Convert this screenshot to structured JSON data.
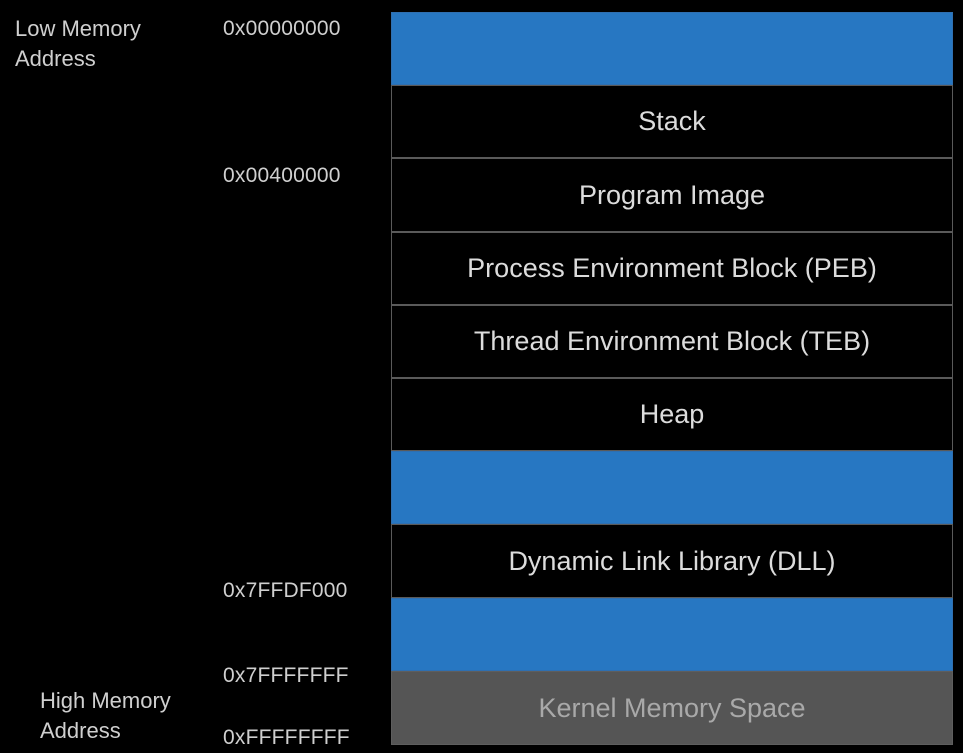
{
  "labels": {
    "low": "Low Memory\nAddress",
    "high": "High Memory\nAddress"
  },
  "addresses": [
    "0x00000000",
    "0x00400000",
    "0x7FFDF000",
    "0x7FFFFFFF",
    "0xFFFFFFFF"
  ],
  "segments": [
    {
      "label": "",
      "kind": "free",
      "color": "#2777c2"
    },
    {
      "label": "Stack",
      "kind": "region",
      "color": "#000000"
    },
    {
      "label": "Program Image",
      "kind": "region",
      "color": "#000000"
    },
    {
      "label": "Process Environment Block (PEB)",
      "kind": "region",
      "color": "#000000"
    },
    {
      "label": "Thread Environment Block (TEB)",
      "kind": "region",
      "color": "#000000"
    },
    {
      "label": "Heap",
      "kind": "region",
      "color": "#000000"
    },
    {
      "label": "",
      "kind": "free",
      "color": "#2777c2"
    },
    {
      "label": "Dynamic Link Library (DLL)",
      "kind": "region",
      "color": "#000000"
    },
    {
      "label": "",
      "kind": "free",
      "color": "#2777c2"
    },
    {
      "label": "Kernel Memory Space",
      "kind": "kernel",
      "color": "#555555"
    }
  ]
}
